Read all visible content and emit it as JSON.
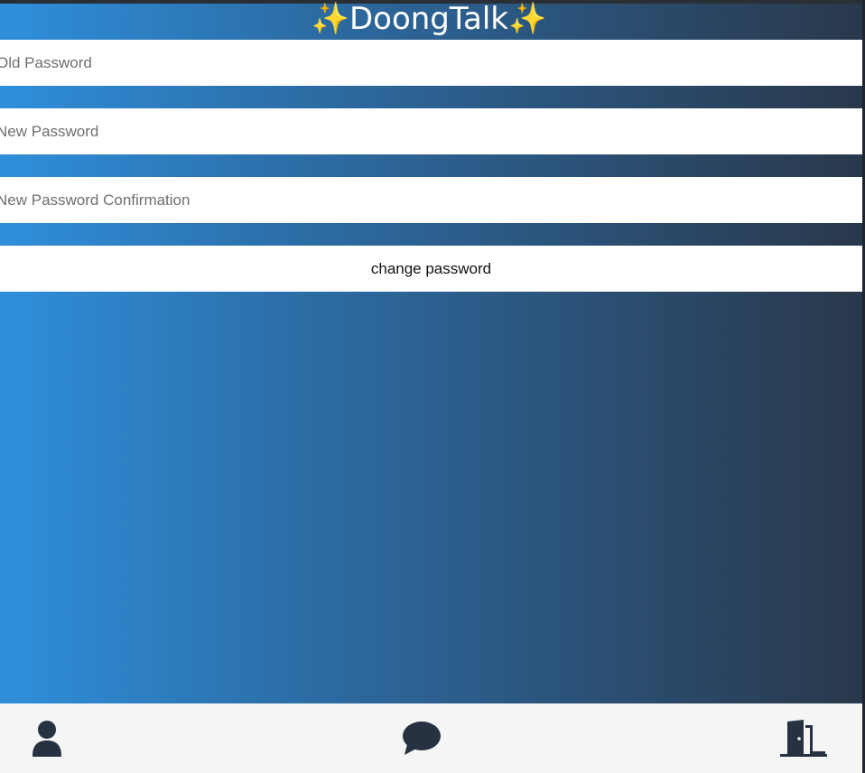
{
  "app": {
    "title": "✨DoongTalk✨"
  },
  "form": {
    "old_password_placeholder": "Old Password",
    "new_password_placeholder": "New Password",
    "confirm_password_placeholder": "New Password Confirmation",
    "submit_label": "change password"
  },
  "nav": {
    "items": [
      {
        "icon": "user-icon"
      },
      {
        "icon": "chat-bubble-icon"
      },
      {
        "icon": "door-open-icon"
      }
    ]
  },
  "colors": {
    "gradient_start": "#2f8fdb",
    "gradient_end": "#29384b",
    "icon": "#263242",
    "nav_background": "#f5f5f5"
  }
}
